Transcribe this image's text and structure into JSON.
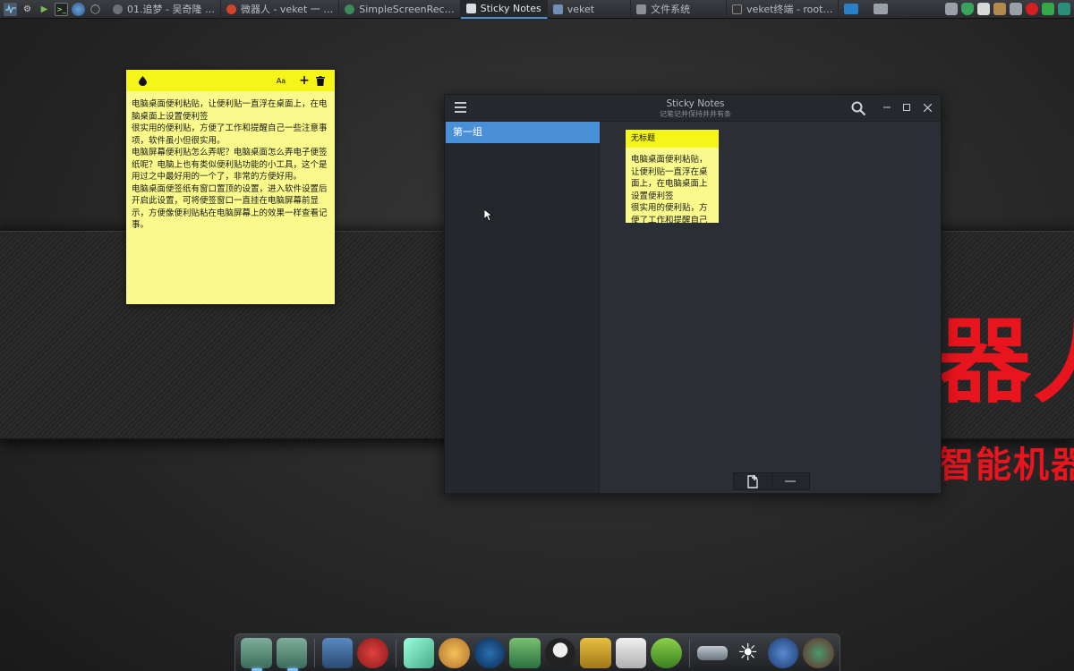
{
  "taskbar": {
    "tasks": [
      {
        "label": "01.追梦 - 吴奇隆 …",
        "icon": "music-icon",
        "active": false
      },
      {
        "label": "微器人 - veket 一 …",
        "icon": "browser-icon",
        "active": false
      },
      {
        "label": "SimpleScreenRec…",
        "icon": "recorder-icon",
        "active": false
      },
      {
        "label": "Sticky Notes",
        "icon": "notes-icon",
        "active": true
      },
      {
        "label": "veket",
        "icon": "folder-icon",
        "active": false
      },
      {
        "label": "文件系统",
        "icon": "folder-icon",
        "active": false
      },
      {
        "label": "veket终端 - root…",
        "icon": "terminal-icon",
        "active": false
      }
    ]
  },
  "desktop_note": {
    "body": "电脑桌面便利粘贴，让便利贴一直浮在桌面上，在电脑桌面上设置便利签\n很实用的便利贴，方便了工作和提醒自己一些注意事项，软件虽小但很实用。\n电脑屏幕便利贴怎么弄呢？电脑桌面怎么弄电子便签纸呢？电脑上也有类似便利贴功能的小工具，这个是用过之中最好用的一个了，非常的方便好用。\n电脑桌面便签纸有窗口置顶的设置，进入软件设置后开启此设置，可将便签窗口一直挂在电脑屏幕前显示，方便像便利贴粘在电脑屏幕上的效果一样查看记事。",
    "font_button": "Aa",
    "add_button": "+"
  },
  "app": {
    "title": "Sticky Notes",
    "subtitle": "记笔记并保持井井有条",
    "groups": [
      {
        "label": "第一组",
        "selected": true
      }
    ],
    "card": {
      "title": "无标题",
      "body": "电脑桌面便利粘贴，让便利贴一直浮在桌面上，在电脑桌面上设置便利签\n很实用的便利贴，方便了工作和提醒自己"
    }
  },
  "wallpaper": {
    "title": "器人",
    "subtitle": "智能机器"
  },
  "colors": {
    "note_header": "#f5f51a",
    "note_body": "#fafa8c",
    "accent": "#4a90d9",
    "wallpaper_text": "#e8141e"
  }
}
